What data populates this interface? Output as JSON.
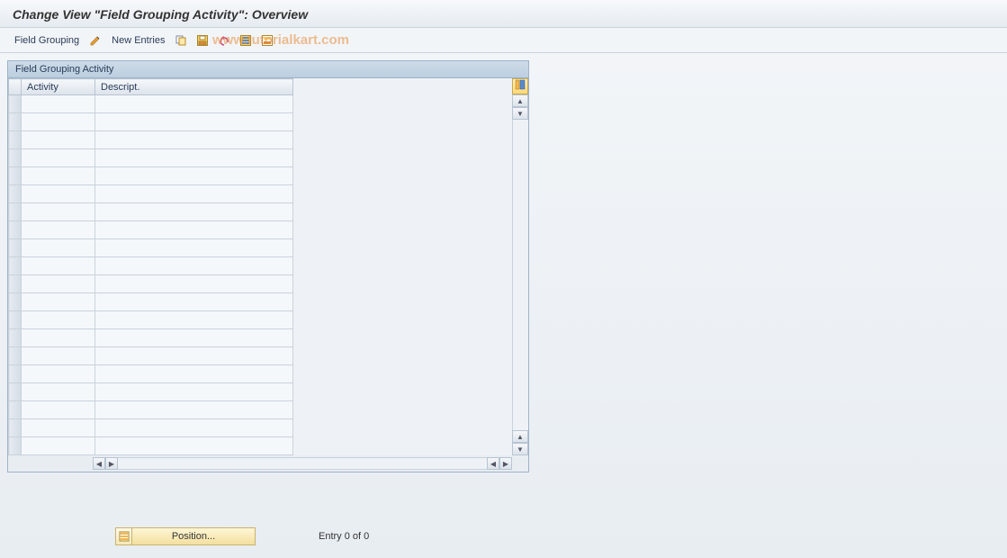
{
  "title": "Change View \"Field Grouping Activity\": Overview",
  "toolbar": {
    "field_grouping_label": "Field Grouping",
    "new_entries_label": "New Entries",
    "icons": {
      "edit": "edit-pencil-icon",
      "copy": "copy-icon",
      "save": "save-variant-icon",
      "undo": "undo-icon",
      "select_all": "select-all-icon",
      "delimit": "delimit-icon"
    }
  },
  "watermark": "www.tutorialkart.com",
  "panel": {
    "header": "Field Grouping Activity",
    "columns": {
      "activity": "Activity",
      "descript": "Descript."
    },
    "row_count": 20
  },
  "footer": {
    "position_label": "Position...",
    "entry_text": "Entry 0 of 0"
  }
}
